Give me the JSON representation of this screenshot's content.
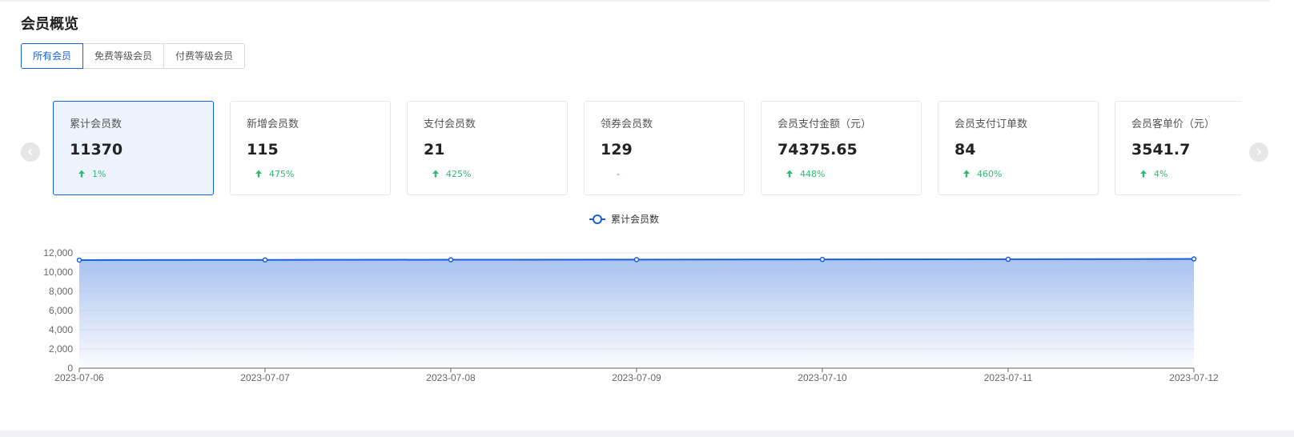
{
  "page": {
    "title": "会员概览"
  },
  "tabs": [
    {
      "label": "所有会员",
      "active": true
    },
    {
      "label": "免费等级会员",
      "active": false
    },
    {
      "label": "付费等级会员",
      "active": false
    }
  ],
  "cards": [
    {
      "label": "累计会员数",
      "value": "11370",
      "change": "1%",
      "trend": "up"
    },
    {
      "label": "新增会员数",
      "value": "115",
      "change": "475%",
      "trend": "up"
    },
    {
      "label": "支付会员数",
      "value": "21",
      "change": "425%",
      "trend": "up"
    },
    {
      "label": "领券会员数",
      "value": "129",
      "change": "-",
      "trend": "none"
    },
    {
      "label": "会员支付金额（元）",
      "value": "74375.65",
      "change": "448%",
      "trend": "up"
    },
    {
      "label": "会员支付订单数",
      "value": "84",
      "change": "460%",
      "trend": "up"
    },
    {
      "label": "会员客单价（元）",
      "value": "3541.7",
      "change": "4%",
      "trend": "up"
    }
  ],
  "icons": {
    "prev": "chevron-left-icon",
    "next": "chevron-right-icon",
    "up": "arrow-up-icon"
  },
  "colors": {
    "accent": "#1a5fd6",
    "up": "#2eb872",
    "none": "#f0453a",
    "area_top": "#a9c2ef"
  },
  "chart_data": {
    "type": "area",
    "x": [
      "2023-07-06",
      "2023-07-07",
      "2023-07-08",
      "2023-07-09",
      "2023-07-10",
      "2023-07-11",
      "2023-07-12"
    ],
    "series": [
      {
        "name": "累计会员数",
        "values": [
          11255,
          11275,
          11290,
          11305,
          11320,
          11340,
          11370
        ]
      }
    ],
    "yticks": [
      "0",
      "2,000",
      "4,000",
      "6,000",
      "8,000",
      "10,000",
      "12,000"
    ],
    "ylim": [
      0,
      12000
    ],
    "legend": "top-center",
    "grid": true
  }
}
